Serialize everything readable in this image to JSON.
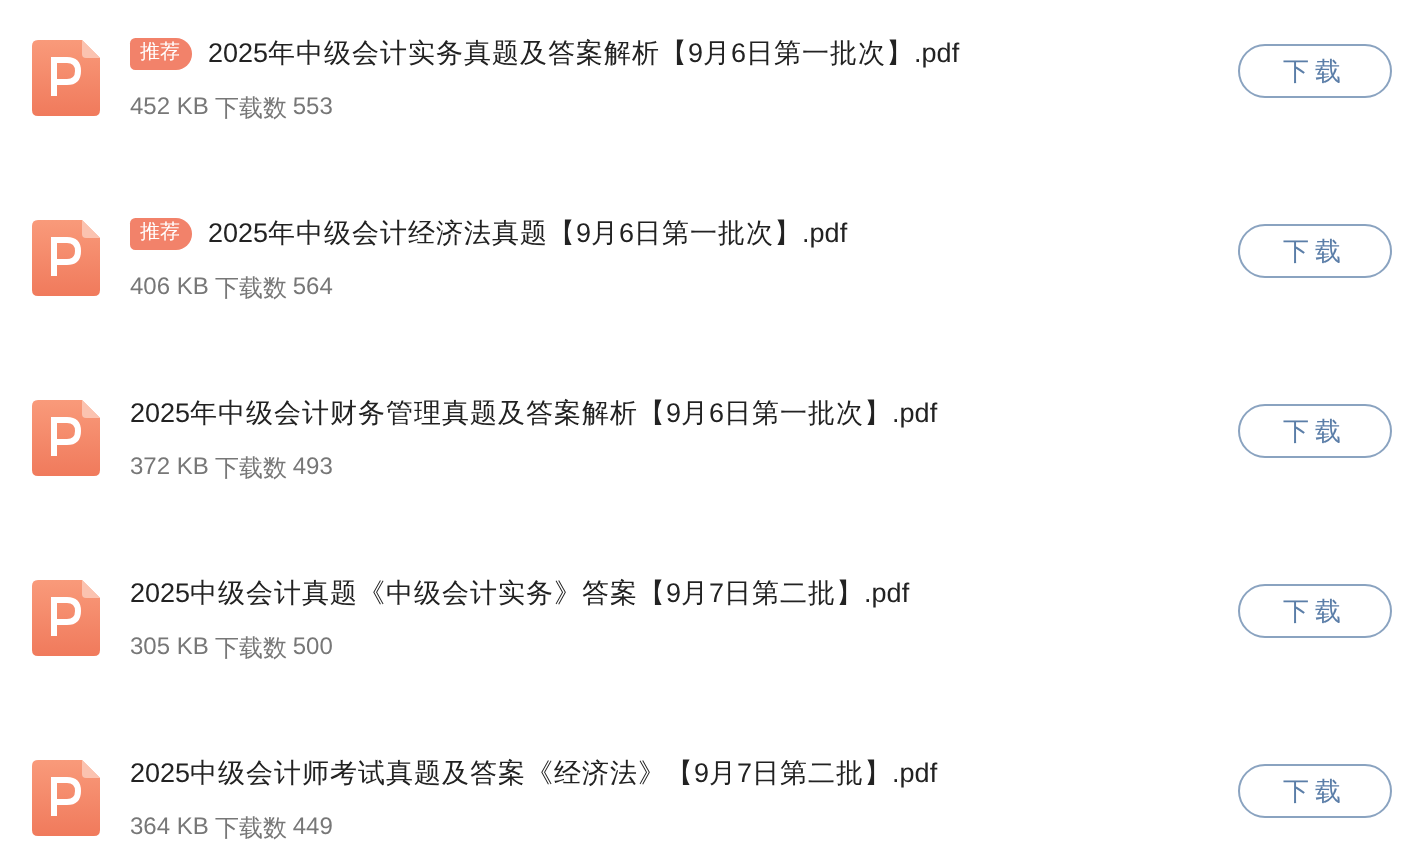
{
  "files": [
    {
      "title": "2025年中级会计实务真题及答案解析【9月6日第一批次】.pdf",
      "badge": "推荐",
      "size": "452 KB",
      "downloads_label": "下载数",
      "downloads": "553",
      "button": "下载"
    },
    {
      "title": "2025年中级会计经济法真题【9月6日第一批次】.pdf",
      "badge": "推荐",
      "size": "406 KB",
      "downloads_label": "下载数",
      "downloads": "564",
      "button": "下载"
    },
    {
      "title": "2025年中级会计财务管理真题及答案解析【9月6日第一批次】.pdf",
      "size": "372 KB",
      "downloads_label": "下载数",
      "downloads": "493",
      "button": "下载"
    },
    {
      "title": "2025中级会计真题《中级会计实务》答案【9月7日第二批】.pdf",
      "size": "305 KB",
      "downloads_label": "下载数",
      "downloads": "500",
      "button": "下载"
    },
    {
      "title": "2025中级会计师考试真题及答案《经济法》【9月7日第二批】.pdf",
      "size": "364 KB",
      "downloads_label": "下载数",
      "downloads": "449",
      "button": "下载"
    }
  ]
}
